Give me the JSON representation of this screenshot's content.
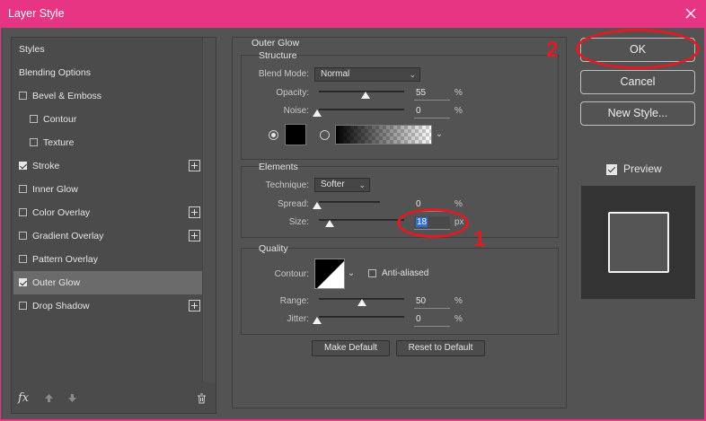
{
  "window": {
    "title": "Layer Style"
  },
  "styles_list": [
    {
      "label": "Styles",
      "checkbox": false,
      "checked": false,
      "indent": false,
      "plus": false,
      "selected": false
    },
    {
      "label": "Blending Options",
      "checkbox": false,
      "checked": false,
      "indent": false,
      "plus": false,
      "selected": false
    },
    {
      "label": "Bevel & Emboss",
      "checkbox": true,
      "checked": false,
      "indent": false,
      "plus": false,
      "selected": false
    },
    {
      "label": "Contour",
      "checkbox": true,
      "checked": false,
      "indent": true,
      "plus": false,
      "selected": false
    },
    {
      "label": "Texture",
      "checkbox": true,
      "checked": false,
      "indent": true,
      "plus": false,
      "selected": false
    },
    {
      "label": "Stroke",
      "checkbox": true,
      "checked": true,
      "indent": false,
      "plus": true,
      "selected": false
    },
    {
      "label": "Inner Glow",
      "checkbox": true,
      "checked": false,
      "indent": false,
      "plus": false,
      "selected": false
    },
    {
      "label": "Color Overlay",
      "checkbox": true,
      "checked": false,
      "indent": false,
      "plus": true,
      "selected": false
    },
    {
      "label": "Gradient Overlay",
      "checkbox": true,
      "checked": false,
      "indent": false,
      "plus": true,
      "selected": false
    },
    {
      "label": "Pattern Overlay",
      "checkbox": true,
      "checked": false,
      "indent": false,
      "plus": false,
      "selected": false
    },
    {
      "label": "Outer Glow",
      "checkbox": true,
      "checked": true,
      "indent": false,
      "plus": false,
      "selected": true
    },
    {
      "label": "Drop Shadow",
      "checkbox": true,
      "checked": false,
      "indent": false,
      "plus": true,
      "selected": false
    }
  ],
  "left_bottom": {
    "fx_label": "fx"
  },
  "outer_glow": {
    "title": "Outer Glow",
    "structure": {
      "title": "Structure",
      "blend_mode_label": "Blend Mode:",
      "blend_mode": "Normal",
      "opacity_label": "Opacity:",
      "opacity": "55",
      "opacity_unit": "%",
      "noise_label": "Noise:",
      "noise": "0",
      "noise_unit": "%",
      "color_mode": "solid",
      "glow_color": "#000000"
    },
    "elements": {
      "title": "Elements",
      "technique_label": "Technique:",
      "technique": "Softer",
      "spread_label": "Spread:",
      "spread": "0",
      "spread_unit": "%",
      "size_label": "Size:",
      "size": "18",
      "size_unit": "px"
    },
    "quality": {
      "title": "Quality",
      "contour_label": "Contour:",
      "anti_aliased_label": "Anti-aliased",
      "anti_aliased": false,
      "range_label": "Range:",
      "range": "50",
      "range_unit": "%",
      "jitter_label": "Jitter:",
      "jitter": "0",
      "jitter_unit": "%"
    },
    "make_default_label": "Make Default",
    "reset_default_label": "Reset to Default"
  },
  "buttons": {
    "ok": "OK",
    "cancel": "Cancel",
    "new_style": "New Style..."
  },
  "preview": {
    "label": "Preview",
    "checked": true
  },
  "annotations": {
    "size_marker": "1",
    "ok_marker": "2",
    "color": "#e01b23"
  },
  "colors": {
    "titlebar": "#e73584",
    "dialog": "#535353",
    "selected_item": "#6b6b6b"
  }
}
